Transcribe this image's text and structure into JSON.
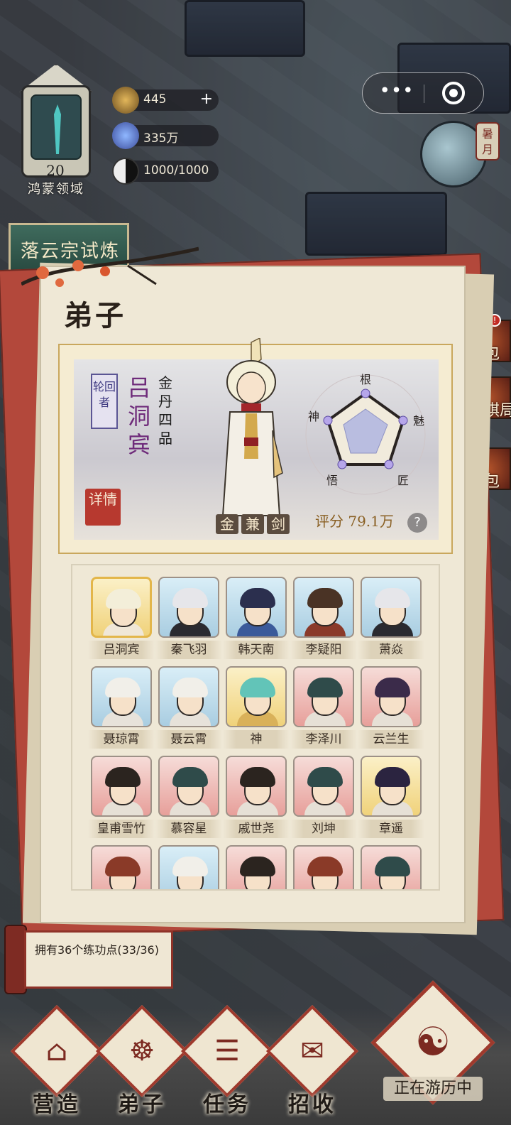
{
  "domain_label": "Computer-Use",
  "sect": {
    "level": "20",
    "name": "鸿蒙领域"
  },
  "resources": [
    {
      "icon": "spirit-stone-icon",
      "value": "445",
      "has_plus": true
    },
    {
      "icon": "crystal-icon",
      "value": "335万",
      "has_plus": false
    },
    {
      "icon": "taiji-icon",
      "value": "1000/1000",
      "has_plus": false
    }
  ],
  "mini_program": {
    "menu": "•••",
    "close": "target-icon"
  },
  "season": {
    "label": "暑月"
  },
  "side_banner": {
    "label": "落云宗试炼"
  },
  "right_buttons": [
    {
      "label": "背包"
    },
    {
      "label": "回棋局"
    },
    {
      "label": "礼包"
    }
  ],
  "panel": {
    "title": "弟子",
    "hero": {
      "role_tag": "轮回者",
      "name": "吕洞宾",
      "rank": "金丹四品",
      "detail": "详情",
      "skills": [
        "金",
        "兼",
        "剑"
      ],
      "score_label": "评分",
      "score_value": "79.1万",
      "help": "?",
      "attributes": [
        "根",
        "魅",
        "匠",
        "悟",
        "神"
      ]
    },
    "disciples": [
      {
        "name": "吕洞宾",
        "bg": "gold",
        "hair": "#f3eed9",
        "cloth": "#f0e7d7"
      },
      {
        "name": "秦飞羽",
        "bg": "blue",
        "hair": "#e6e6ea",
        "cloth": "#2a2a30"
      },
      {
        "name": "韩天南",
        "bg": "blue",
        "hair": "#2b2f4e",
        "cloth": "#3b5a9a"
      },
      {
        "name": "李疑阳",
        "bg": "blue",
        "hair": "#4a3325",
        "cloth": "#8a3a2a"
      },
      {
        "name": "萧焱",
        "bg": "blue",
        "hair": "#e6e6ea",
        "cloth": "#2a2a30"
      },
      {
        "name": "聂琼霄",
        "bg": "blue",
        "hair": "#f1efe9",
        "cloth": "#e7e2da"
      },
      {
        "name": "聂云霄",
        "bg": "blue",
        "hair": "#f1efe9",
        "cloth": "#e7e2da"
      },
      {
        "name": "神",
        "bg": "gold",
        "hair": "#62c4b8",
        "cloth": "#d9b15a"
      },
      {
        "name": "李泽川",
        "bg": "red",
        "hair": "#2f4b4a",
        "cloth": "#e6e0d6"
      },
      {
        "name": "云兰生",
        "bg": "red",
        "hair": "#3b2b4a",
        "cloth": "#e6e0d6"
      },
      {
        "name": "皇甫雪竹",
        "bg": "red",
        "hair": "#2b241f",
        "cloth": "#e6e0d6"
      },
      {
        "name": "慕容星",
        "bg": "red",
        "hair": "#2f4b4a",
        "cloth": "#e6e0d6"
      },
      {
        "name": "戚世尧",
        "bg": "red",
        "hair": "#2b241f",
        "cloth": "#e6e0d6"
      },
      {
        "name": "刘坤",
        "bg": "red",
        "hair": "#2f4b4a",
        "cloth": "#e6e0d6"
      },
      {
        "name": "章遥",
        "bg": "gold",
        "hair": "#2b2440",
        "cloth": "#e6e0d6"
      },
      {
        "name": "",
        "bg": "red",
        "hair": "#8a3a28",
        "cloth": "#e6e0d6"
      },
      {
        "name": "",
        "bg": "blue",
        "hair": "#f1efe9",
        "cloth": "#e7e2da"
      },
      {
        "name": "",
        "bg": "red",
        "hair": "#2b241f",
        "cloth": "#e6e0d6"
      },
      {
        "name": "",
        "bg": "red",
        "hair": "#8a3a28",
        "cloth": "#e6e0d6"
      },
      {
        "name": "",
        "bg": "red",
        "hair": "#2f4b4a",
        "cloth": "#e6e0d6"
      }
    ]
  },
  "hint": {
    "text": "拥有36个练功点(33/36)"
  },
  "nav": [
    {
      "label": "营造",
      "glyph": "⌂"
    },
    {
      "label": "弟子",
      "glyph": "☸"
    },
    {
      "label": "任务",
      "glyph": "☰"
    },
    {
      "label": "招收",
      "glyph": "✉"
    }
  ],
  "travel": {
    "label": "正在游历中",
    "glyph": "☯"
  },
  "colors": {
    "accent_red": "#9f3a2d",
    "paper": "#efe8d6",
    "name_purple": "#6e2a7a",
    "score_gold": "#8a6024"
  }
}
